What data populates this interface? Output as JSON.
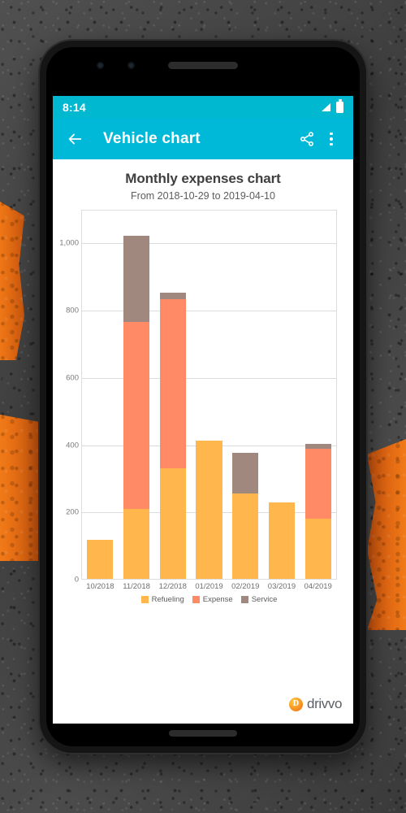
{
  "status_bar": {
    "time": "8:14",
    "signal_icon": "signal-bars-icon",
    "battery_icon": "battery-full-icon"
  },
  "app_bar": {
    "back_icon": "back-arrow-icon",
    "title": "Vehicle chart",
    "share_icon": "share-icon",
    "overflow_icon": "more-options-icon"
  },
  "navigation_bar": {
    "back": "nav-back",
    "home": "nav-home",
    "recents": "nav-recents"
  },
  "brand": {
    "name": "drivvo",
    "mark": "D"
  },
  "chart_data": {
    "type": "bar",
    "stacked": true,
    "title": "Monthly expenses chart",
    "subtitle": "From 2018-10-29 to 2019-04-10",
    "xlabel": "",
    "ylabel": "",
    "categories": [
      "10/2018",
      "11/2018",
      "12/2018",
      "01/2019",
      "02/2019",
      "03/2019",
      "04/2019"
    ],
    "series": [
      {
        "name": "Refueling",
        "color": "#FFB74D",
        "values": [
          117,
          207,
          330,
          410,
          254,
          228,
          178
        ]
      },
      {
        "name": "Expense",
        "color": "#FF8A65",
        "values": [
          0,
          558,
          502,
          0,
          0,
          0,
          209
        ]
      },
      {
        "name": "Service",
        "color": "#A1887F",
        "values": [
          0,
          255,
          18,
          0,
          120,
          0,
          15
        ]
      }
    ],
    "totals": [
      117,
      1020,
      850,
      410,
      374,
      228,
      402
    ],
    "ylim": [
      0,
      1100
    ],
    "yticks": [
      0,
      200,
      400,
      600,
      800,
      1000
    ],
    "ytick_labels": [
      "0",
      "200",
      "400",
      "600",
      "800",
      "1,000"
    ],
    "grid": true,
    "legend_position": "bottom",
    "legend": [
      "Refueling",
      "Expense",
      "Service"
    ]
  },
  "colors": {
    "accent": "#00B8D8",
    "status_bar": "#00B8D0",
    "refueling": "#FFB74D",
    "expense": "#FF8A65",
    "service": "#A1887F",
    "grid": "#DCDCDC",
    "title_text": "#3F3F3F"
  }
}
